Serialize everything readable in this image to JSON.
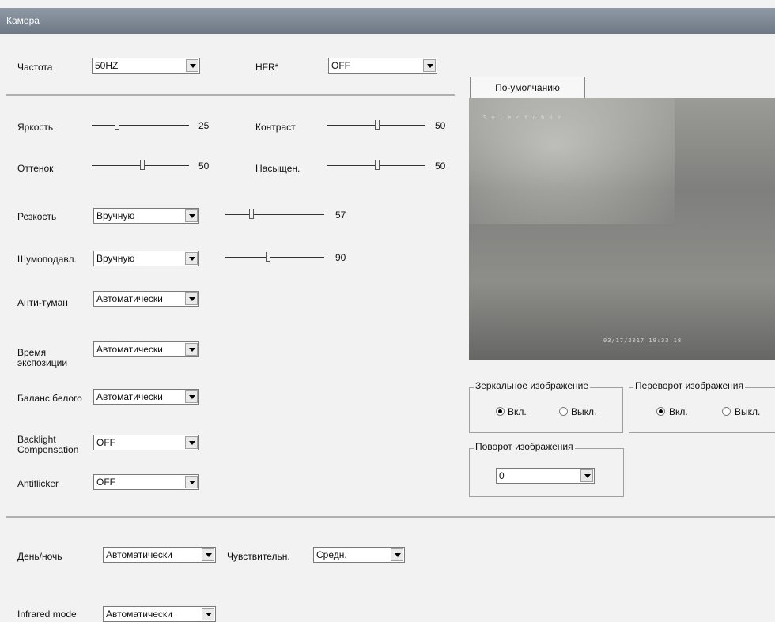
{
  "window": {
    "title": "Камера"
  },
  "frequency": {
    "label": "Частота",
    "value": "50HZ"
  },
  "hfr": {
    "label": "HFR*",
    "value": "OFF"
  },
  "brightness": {
    "label": "Яркость",
    "value": 25
  },
  "contrast": {
    "label": "Контраст",
    "value": 50
  },
  "hue": {
    "label": "Оттенок",
    "value": 50
  },
  "saturation": {
    "label": "Насыщен.",
    "value": 50
  },
  "sharpness": {
    "label": "Резкость",
    "mode": "Вручную",
    "value": 57
  },
  "noise": {
    "label": "Шумоподавл.",
    "mode": "Вручную",
    "value": 90
  },
  "antifog": {
    "label": "Анти-туман",
    "value": "Автоматически"
  },
  "exposure": {
    "label": "Время экспозиции",
    "value": "Автоматически"
  },
  "white_balance": {
    "label": "Баланс белого",
    "value": "Автоматически"
  },
  "backlight": {
    "label": "Backlight Compensation",
    "value": "OFF"
  },
  "antiflicker": {
    "label": "Antiflicker",
    "value": "OFF"
  },
  "day_night": {
    "label": "День/ночь",
    "value": "Автоматически"
  },
  "sensitivity": {
    "label": "Чувствительн.",
    "value": "Средн."
  },
  "infrared": {
    "label": "Infrared mode",
    "value": "Автоматически"
  },
  "preview": {
    "tab_label": "По-умолчанию",
    "osd_name": "S e l e c t o b o z",
    "osd_time": "03/17/2017 19:33:18"
  },
  "mirror": {
    "title": "Зеркальное изображение",
    "on_label": "Вкл.",
    "off_label": "Выкл.",
    "selected": "on"
  },
  "flip": {
    "title": "Переворот изображения",
    "on_label": "Вкл.",
    "off_label": "Выкл.",
    "selected": "on"
  },
  "rotation": {
    "title": "Поворот изображения",
    "value": "0"
  }
}
